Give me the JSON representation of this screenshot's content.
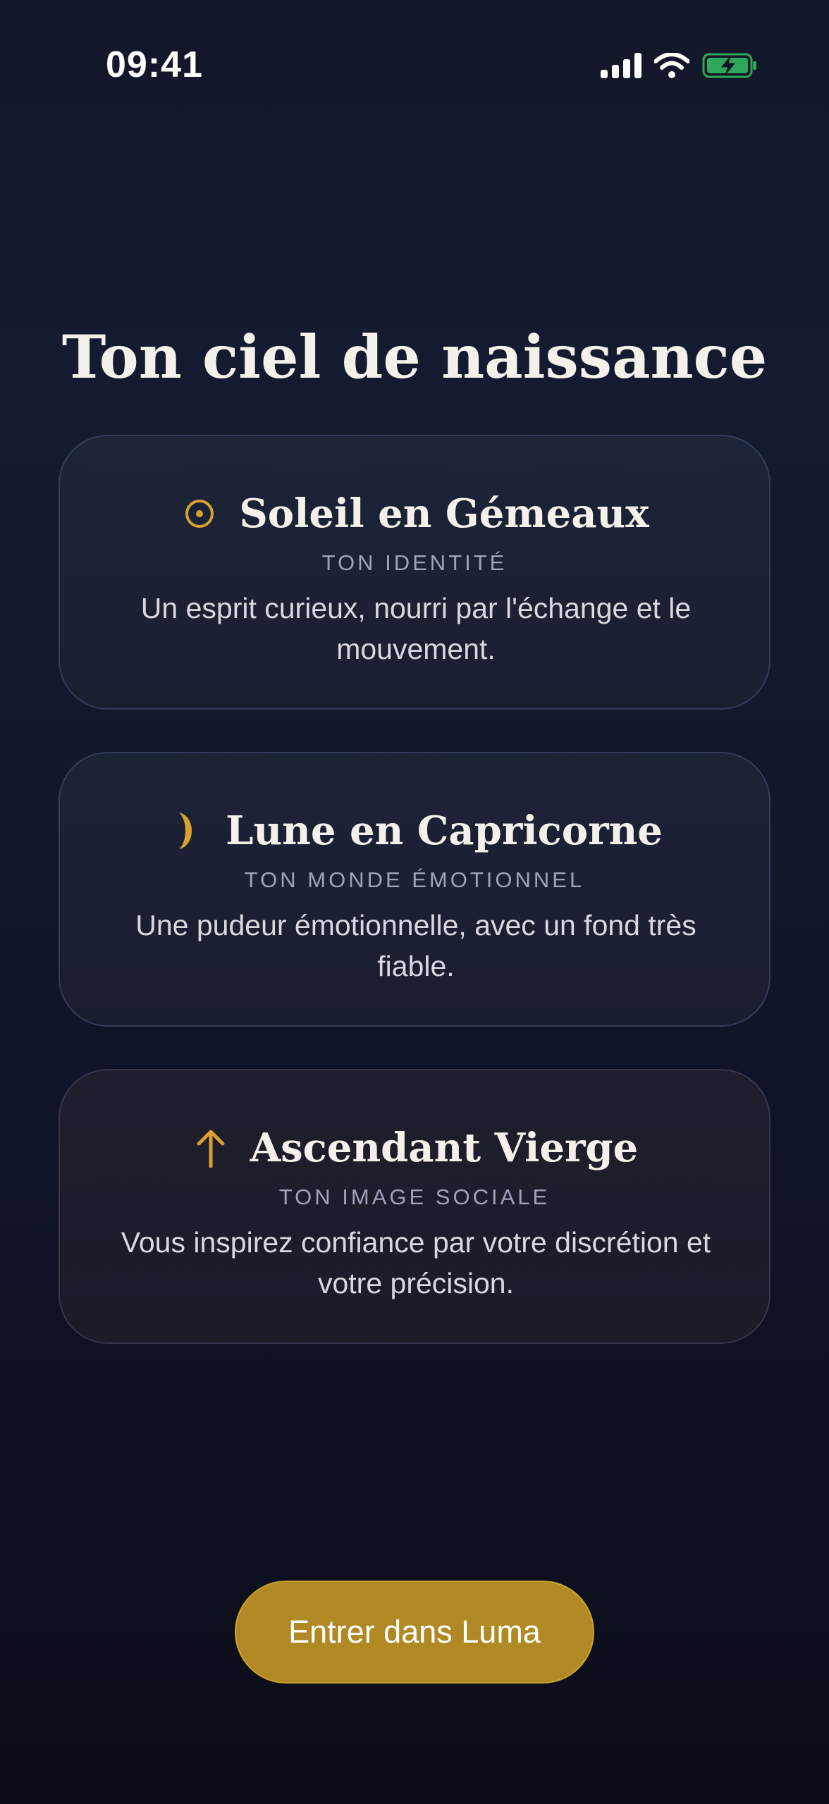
{
  "status_bar": {
    "time": "09:41",
    "icons": [
      "cellular-signal-icon",
      "wifi-icon",
      "battery-charging-icon"
    ],
    "battery_color": "#2ea85a"
  },
  "title": "Ton ciel de naissance",
  "accent_color": "#d9a030",
  "cards": [
    {
      "icon": "sun-icon",
      "title": "Soleil en Gémeaux",
      "label": "TON IDENTITÉ",
      "description": "Un esprit curieux, nourri par l'échange et le mouvement."
    },
    {
      "icon": "moon-icon",
      "title": "Lune en Capricorne",
      "label": "TON MONDE ÉMOTIONNEL",
      "description": "Une pudeur émotionnelle, avec un fond très fiable."
    },
    {
      "icon": "arrow-up-icon",
      "title": "Ascendant Vierge",
      "label": "TON IMAGE SOCIALE",
      "description": "Vous inspirez confiance par votre discrétion et votre précision."
    }
  ],
  "cta": {
    "label": "Entrer dans Luma",
    "color": "#b08924"
  }
}
